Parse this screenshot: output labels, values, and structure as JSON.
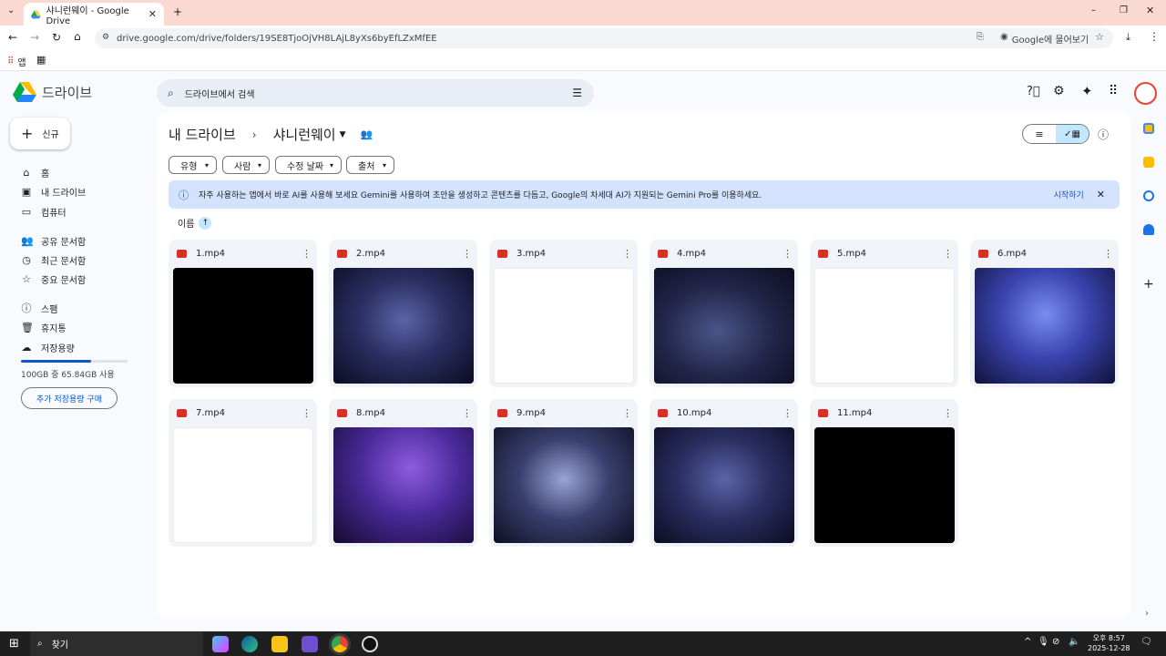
{
  "browser": {
    "tab_title": "샤니런웨이 - Google Drive",
    "url": "drive.google.com/drive/folders/19SE8TjoOjVH8LAjL8yXs6byEfLZxMfEE",
    "lens_label": "Google에 물어보기",
    "bookmark_apps": "앱"
  },
  "drive": {
    "logo_text": "드라이브",
    "search_placeholder": "드라이브에서 검색",
    "new_button": "신규",
    "nav": [
      {
        "label": "홈",
        "icon": "home-icon"
      },
      {
        "label": "내 드라이브",
        "icon": "drive-icon"
      },
      {
        "label": "컴퓨터",
        "icon": "computer-icon"
      },
      {
        "label": "공유 문서함",
        "icon": "shared-icon"
      },
      {
        "label": "최근 문서함",
        "icon": "clock-icon"
      },
      {
        "label": "중요 문서함",
        "icon": "star-icon"
      },
      {
        "label": "스팸",
        "icon": "spam-icon"
      },
      {
        "label": "휴지통",
        "icon": "trash-icon"
      },
      {
        "label": "저장용량",
        "icon": "cloud-icon"
      }
    ],
    "storage_text": "100GB 중 65.84GB 사용",
    "storage_fraction": 0.6584,
    "buy_storage": "추가 저장용량 구매",
    "breadcrumb_root": "내 드라이브",
    "breadcrumb_folder": "샤니런웨이",
    "filters": [
      "유형",
      "사람",
      "수정 날짜",
      "출처"
    ],
    "banner_text": "자주 사용하는 앱에서 바로 AI를 사용해 보세요 Gemini를 사용하여 초안을 생성하고 콘텐츠를 다듬고, Google의 차세대 AI가 지원되는 Gemini Pro를 이용하세요.",
    "banner_action": "시작하기",
    "sort_label": "이름",
    "files": [
      {
        "name": "1.mp4",
        "thumb": "black"
      },
      {
        "name": "2.mp4",
        "thumb": "stage-blue"
      },
      {
        "name": "3.mp4",
        "thumb": "white"
      },
      {
        "name": "4.mp4",
        "thumb": "smoke"
      },
      {
        "name": "5.mp4",
        "thumb": "white"
      },
      {
        "name": "6.mp4",
        "thumb": "stage-bright"
      },
      {
        "name": "7.mp4",
        "thumb": "white"
      },
      {
        "name": "8.mp4",
        "thumb": "purple"
      },
      {
        "name": "9.mp4",
        "thumb": "stage-smoke"
      },
      {
        "name": "10.mp4",
        "thumb": "stage-blue"
      },
      {
        "name": "11.mp4",
        "thumb": "black"
      }
    ]
  },
  "taskbar": {
    "search": "찾기",
    "time": "오후 8:57",
    "date": "2025-12-28"
  },
  "colors": {
    "accent": "#0b57d0",
    "banner_bg": "#d3e3fd",
    "video_red": "#d93025"
  }
}
